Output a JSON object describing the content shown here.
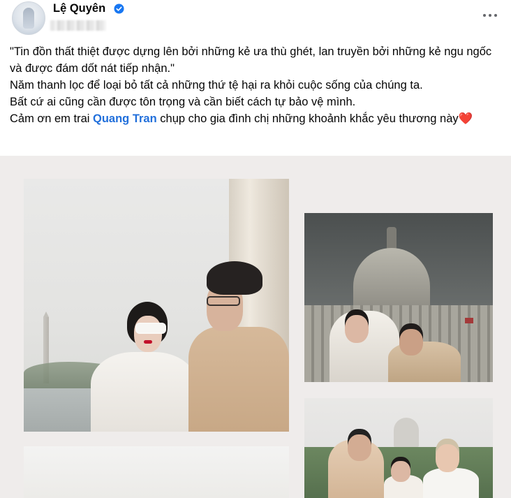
{
  "post": {
    "author": "Lệ Quyên",
    "more_icon": "three-dots-icon",
    "verified_icon": "verified-badge-icon",
    "lines": [
      "\"Tin đồn thất thiệt được dựng lên bởi những kẻ ưa thù ghét, lan truyền bởi những kẻ ngu ngốc và được đám dốt nát tiếp nhận.\"",
      "Năm thanh lọc để loại bỏ tất cả những thứ tệ hại ra khỏi cuộc sống của chúng ta.",
      "Bất cứ ai cũng cần được tôn trọng và cần biết cách tự bảo vệ mình."
    ],
    "thanks_prefix": "Cảm ơn em trai ",
    "mention": "Quang Tran",
    "thanks_suffix": " chụp cho gia đình chị những khoảnh khắc yêu thương này",
    "heart": "❤️"
  },
  "colors": {
    "mention": "#216fdb",
    "verified": "#1877f2",
    "heart": "#e41e3f",
    "gallery_bg": "#efeceb"
  }
}
